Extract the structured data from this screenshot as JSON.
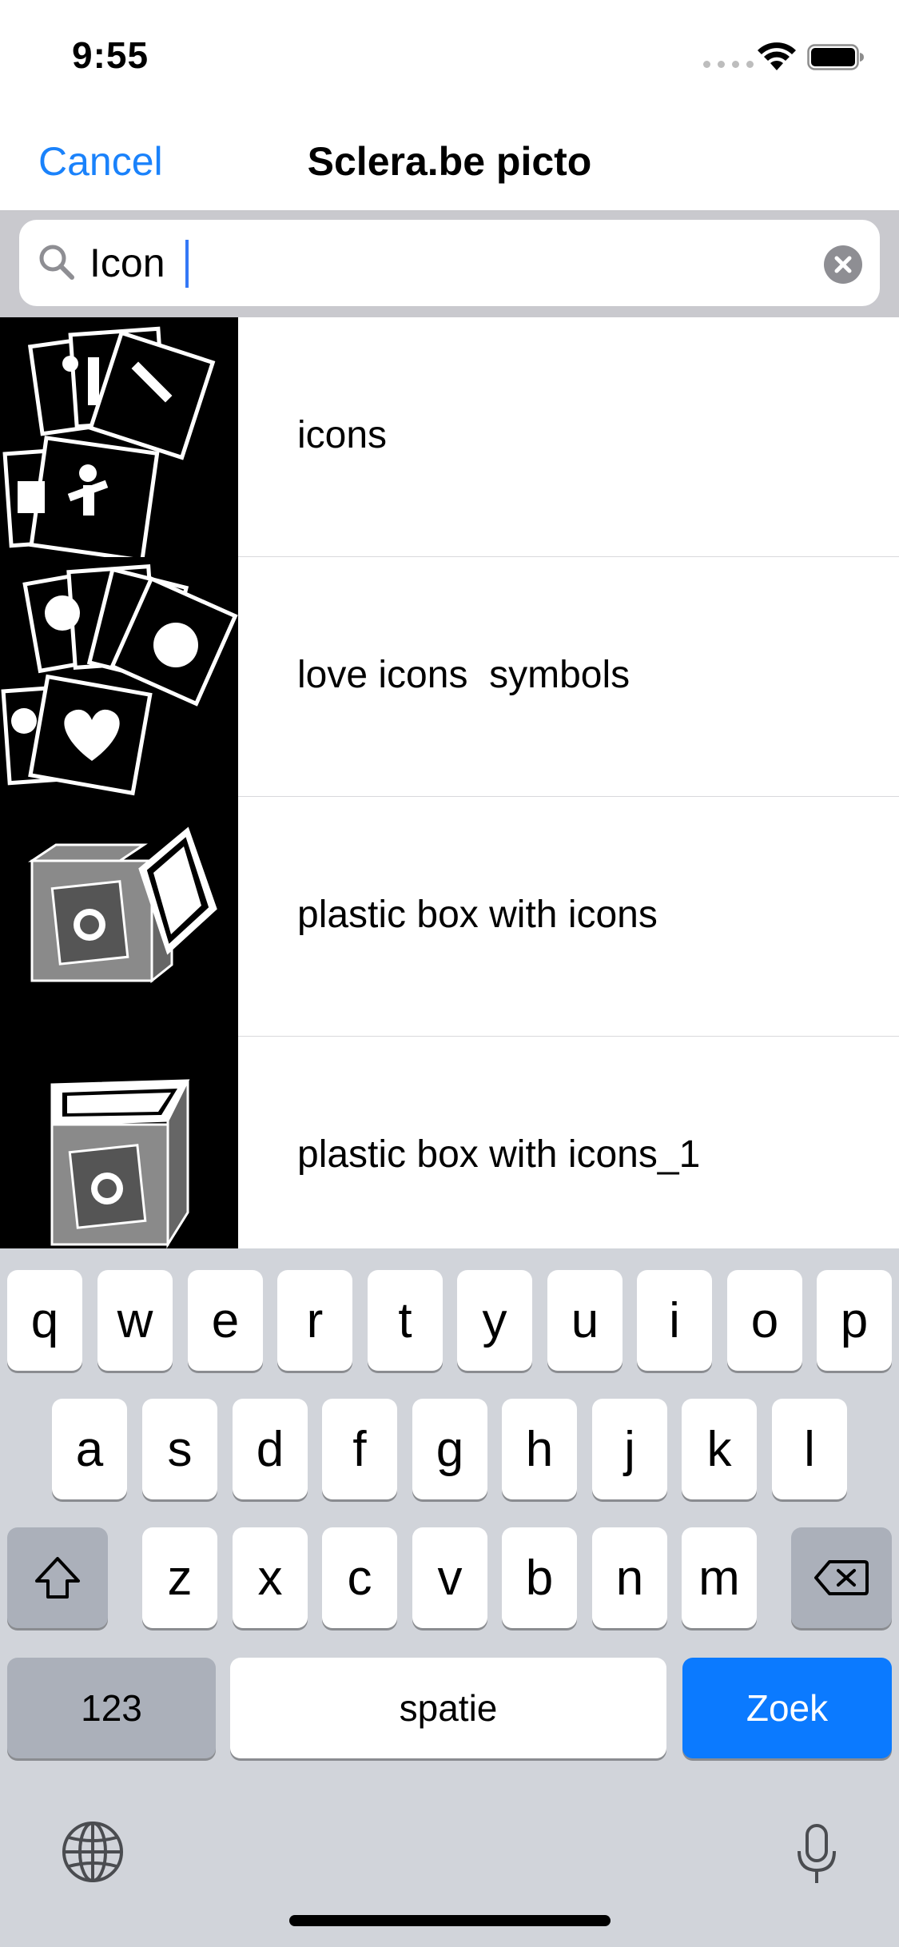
{
  "status_bar": {
    "time": "9:55",
    "wifi_icon": "wifi-icon",
    "battery_icon": "battery-icon"
  },
  "nav": {
    "cancel_label": "Cancel",
    "title": "Sclera.be picto",
    "accent_color": "#1a82fb"
  },
  "search": {
    "value": "Icon",
    "search_icon": "search-icon",
    "clear_icon": "clear-circle-icon"
  },
  "results": [
    {
      "label": "icons",
      "thumbnail": "icons-collage-pictogram"
    },
    {
      "label": "love icons  symbols",
      "thumbnail": "love-symbols-pictogram"
    },
    {
      "label": "plastic box with icons",
      "thumbnail": "plastic-box-open-pictogram"
    },
    {
      "label": "plastic box with icons_1",
      "thumbnail": "plastic-box-closed-pictogram"
    }
  ],
  "keyboard": {
    "row1": [
      "q",
      "w",
      "e",
      "r",
      "t",
      "y",
      "u",
      "i",
      "o",
      "p"
    ],
    "row2": [
      "a",
      "s",
      "d",
      "f",
      "g",
      "h",
      "j",
      "k",
      "l"
    ],
    "row3": [
      "z",
      "x",
      "c",
      "v",
      "b",
      "n",
      "m"
    ],
    "numbers_label": "123",
    "space_label": "spatie",
    "return_label": "Zoek",
    "return_color": "#0b7aff",
    "shift_icon": "shift-icon",
    "delete_icon": "delete-icon",
    "globe_icon": "globe-icon",
    "mic_icon": "microphone-icon"
  }
}
